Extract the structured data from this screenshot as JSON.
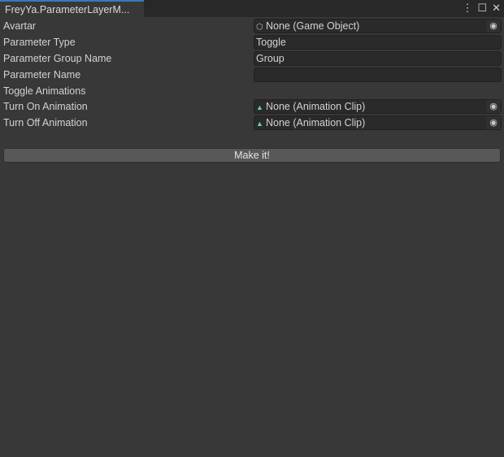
{
  "window": {
    "tab_title": "FreyYa.ParameterLayerM..."
  },
  "fields": [
    {
      "label": "Avartar",
      "value": "None (Game Object)",
      "kind": "object",
      "icon": "cube-icon"
    },
    {
      "label": "Parameter Type",
      "value": "Toggle",
      "kind": "text"
    },
    {
      "label": "Parameter Group Name",
      "value": "Group",
      "kind": "text"
    },
    {
      "label": "Parameter Name",
      "value": "",
      "kind": "text"
    },
    {
      "label": "Toggle Animations"
    },
    {
      "label": "Turn On Animation",
      "value": "None (Animation Clip)",
      "kind": "object",
      "icon": "animation-clip-icon"
    },
    {
      "label": "Turn Off Animation",
      "value": "None (Animation Clip)",
      "kind": "object",
      "icon": "animation-clip-icon"
    }
  ],
  "button": {
    "label": "Make it!"
  },
  "colors": {
    "accent": "#3a79bb",
    "background": "#383838"
  }
}
